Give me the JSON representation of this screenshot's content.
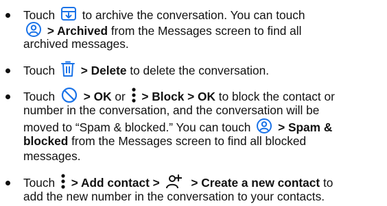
{
  "items": [
    {
      "lines": [
        {
          "t1": "Touch",
          "t2": "to archive the conversation. You can touch"
        },
        {
          "t1": "> Archived",
          "t2": "from the Messages screen to find all"
        },
        {
          "t1": "archived messages."
        }
      ],
      "icons": [
        "archive-icon",
        "account-icon"
      ]
    },
    {
      "lines": [
        {
          "t1": "Touch",
          "t2": "> Delete",
          "t3": "to delete the conversation."
        }
      ],
      "icons": [
        "trash-icon"
      ]
    },
    {
      "lines": [
        {
          "t1": "Touch",
          "t2": "> OK",
          "t3": "or",
          "t4": "> Block > OK",
          "t5": "to block the contact or"
        },
        {
          "t1": "number in the conversation, and the conversation will be"
        },
        {
          "t1": "moved to “Spam & blocked.” You can touch",
          "t2": "> Spam &"
        },
        {
          "t1": "blocked",
          "t2": "from the Messages screen to find all blocked"
        },
        {
          "t1": "messages."
        }
      ],
      "icons": [
        "block-icon",
        "more-vert-icon",
        "account-icon"
      ]
    },
    {
      "lines": [
        {
          "t1": "Touch",
          "t2": "> Add contact >",
          "t3": "> Create a new contact",
          "t4": "to"
        },
        {
          "t1": "add the new number in the conversation to your contacts."
        }
      ],
      "icons": [
        "more-vert-icon",
        "add-person-icon"
      ]
    }
  ],
  "colors": {
    "text": "#111111",
    "icon_accent": "#1a73e8"
  }
}
